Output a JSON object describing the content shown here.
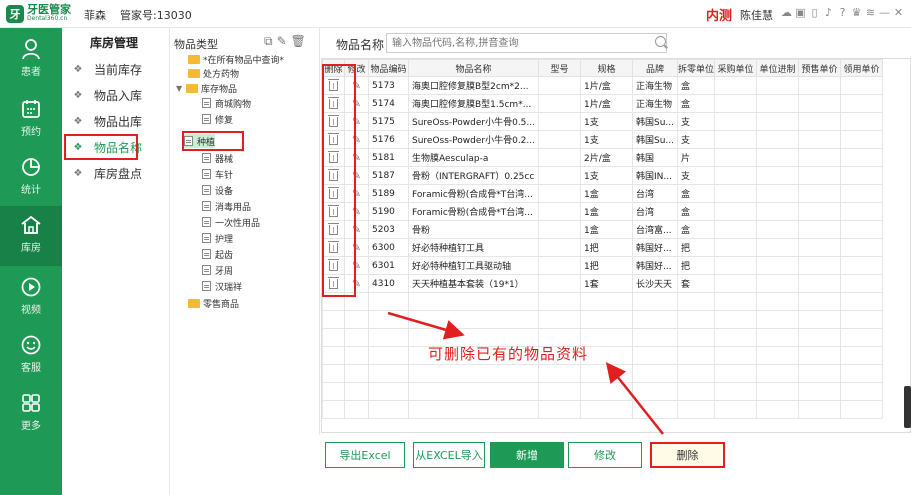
{
  "topbar": {
    "logo_mark": "牙",
    "logo_cn": "牙医管家",
    "logo_en": "Dental360.cn",
    "clinic": "菲森",
    "account": "管家号:13030",
    "env": "内测",
    "user": "陈佳慧",
    "icons": [
      "chat-icon",
      "message-icon",
      "phone-icon",
      "bell-icon",
      "help-icon",
      "gift-icon",
      "wifi-icon",
      "minimize-icon",
      "close-icon"
    ]
  },
  "nav": [
    {
      "label": "患者",
      "icon": "user-icon"
    },
    {
      "label": "预约",
      "icon": "calendar-icon"
    },
    {
      "label": "统计",
      "icon": "chart-icon"
    },
    {
      "label": "库房",
      "icon": "warehouse-icon",
      "active": true
    },
    {
      "label": "视频",
      "icon": "play-icon"
    },
    {
      "label": "客服",
      "icon": "service-icon"
    },
    {
      "label": "更多",
      "icon": "grid-icon"
    }
  ],
  "submenu": {
    "title": "库房管理",
    "items": [
      "当前库存",
      "物品入库",
      "物品出库",
      "物品名称",
      "库房盘点"
    ]
  },
  "category": {
    "header": "物品类型",
    "tree": [
      {
        "label": "*在所有物品中查询*",
        "kind": "folder"
      },
      {
        "label": "处方药物",
        "kind": "folder"
      },
      {
        "label": "库存物品",
        "kind": "folder-open"
      },
      {
        "label": "商城购物",
        "kind": "doc"
      },
      {
        "label": "修复",
        "kind": "doc"
      },
      {
        "label": "种植",
        "kind": "doc",
        "selected": true
      },
      {
        "label": "器械",
        "kind": "doc"
      },
      {
        "label": "车针",
        "kind": "doc"
      },
      {
        "label": "设备",
        "kind": "doc"
      },
      {
        "label": "消毒用品",
        "kind": "doc"
      },
      {
        "label": "一次性用品",
        "kind": "doc"
      },
      {
        "label": "护理",
        "kind": "doc"
      },
      {
        "label": "起齿",
        "kind": "doc"
      },
      {
        "label": "牙周",
        "kind": "doc"
      },
      {
        "label": "汉瑞祥",
        "kind": "doc"
      },
      {
        "label": "零售商品",
        "kind": "folder"
      }
    ]
  },
  "search": {
    "label": "物品名称",
    "placeholder": "输入物品代码,名称,拼音查询"
  },
  "grid": {
    "columns": [
      "删除",
      "修改",
      "物品编码",
      "物品名称",
      "型号",
      "规格",
      "品牌",
      "拆零单位",
      "采购单位",
      "单位进制",
      "预售单价",
      "领用单价"
    ],
    "rows": [
      {
        "code": "5173",
        "name": "海奥口腔修复膜B型2cm*2...",
        "model": "",
        "spec": "1片/盒",
        "brand": "正海生物",
        "unit": "盒"
      },
      {
        "code": "5174",
        "name": "海奥口腔修复膜B型1.5cm*...",
        "model": "",
        "spec": "1片/盒",
        "brand": "正海生物",
        "unit": "盒"
      },
      {
        "code": "5175",
        "name": "SureOss-Powder小牛骨0.5...",
        "model": "",
        "spec": "1支",
        "brand": "韩国Su...",
        "unit": "支"
      },
      {
        "code": "5176",
        "name": "SureOss-Powder小牛骨0.2...",
        "model": "",
        "spec": "1支",
        "brand": "韩国Su...",
        "unit": "支"
      },
      {
        "code": "5181",
        "name": "生物膜Aesculap-a",
        "model": "",
        "spec": "2片/盒",
        "brand": "韩国",
        "unit": "片"
      },
      {
        "code": "5187",
        "name": "骨粉（INTERGRAFT）0.25cc",
        "model": "",
        "spec": "1支",
        "brand": "韩国IN...",
        "unit": "支"
      },
      {
        "code": "5189",
        "name": "Foramic骨粉(合成骨*T台湾...",
        "model": "",
        "spec": "1盒",
        "brand": "台湾",
        "unit": "盒"
      },
      {
        "code": "5190",
        "name": "Foramic骨粉(合成骨*T台湾...",
        "model": "",
        "spec": "1盒",
        "brand": "台湾",
        "unit": "盒"
      },
      {
        "code": "5203",
        "name": "骨粉",
        "model": "",
        "spec": "1盒",
        "brand": "台湾富...",
        "unit": "盒"
      },
      {
        "code": "6300",
        "name": "好必特种植钉工具",
        "model": "",
        "spec": "1把",
        "brand": "韩国好...",
        "unit": "把"
      },
      {
        "code": "6301",
        "name": "好必特种植钉工具驱动轴",
        "model": "",
        "spec": "1把",
        "brand": "韩国好...",
        "unit": "把"
      },
      {
        "code": "4310",
        "name": "天天种植基本套装（19*1）",
        "model": "",
        "spec": "1套",
        "brand": "长沙天天",
        "unit": "套"
      }
    ],
    "empty_rows": 7
  },
  "annotation": "可删除已有的物品资料",
  "buttons": {
    "export": "导出Excel",
    "import": "从EXCEL导入",
    "add": "新增",
    "edit": "修改",
    "delete": "删除"
  },
  "colors": {
    "brand": "#1f9a56",
    "highlight": "#e02020"
  }
}
